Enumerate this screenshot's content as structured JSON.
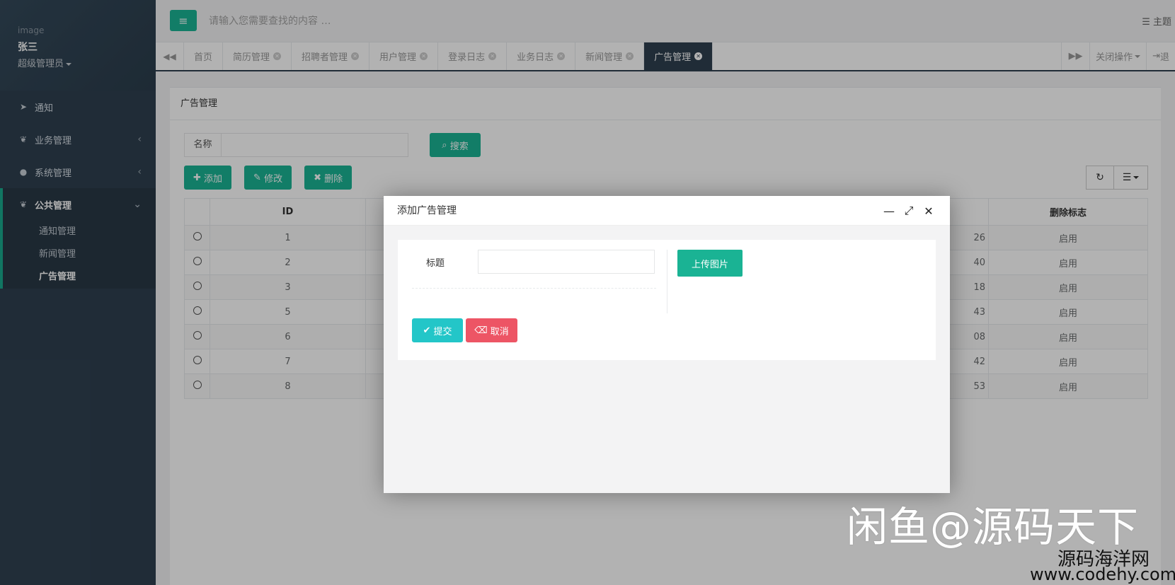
{
  "sidebar": {
    "profile": {
      "image_alt": "image",
      "name": "张三",
      "role": "超级管理员"
    },
    "items": [
      {
        "label": "通知"
      },
      {
        "label": "业务管理"
      },
      {
        "label": "系统管理"
      },
      {
        "label": "公共管理"
      }
    ],
    "sub_items": [
      {
        "label": "通知管理"
      },
      {
        "label": "新闻管理"
      },
      {
        "label": "广告管理"
      }
    ]
  },
  "topbar": {
    "search_placeholder": "请输入您需要查找的内容 …",
    "theme_label": "主题"
  },
  "tabs": {
    "items": [
      {
        "label": "首页"
      },
      {
        "label": "简历管理"
      },
      {
        "label": "招聘者管理"
      },
      {
        "label": "用户管理"
      },
      {
        "label": "登录日志"
      },
      {
        "label": "业务日志"
      },
      {
        "label": "新闻管理"
      },
      {
        "label": "广告管理"
      }
    ],
    "close_ops_label": "关闭操作",
    "logout_label": "退"
  },
  "page": {
    "title": "广告管理",
    "search_label": "名称",
    "search_button": "搜索",
    "add_button": "添加",
    "edit_button": "修改",
    "delete_button": "删除"
  },
  "table": {
    "headers": {
      "id": "ID",
      "flag": "删除标志"
    },
    "rows": [
      {
        "id": "1",
        "partial": "26",
        "flag": "启用"
      },
      {
        "id": "2",
        "partial": "40",
        "flag": "启用"
      },
      {
        "id": "3",
        "partial": "18",
        "flag": "启用"
      },
      {
        "id": "5",
        "partial": "43",
        "flag": "启用"
      },
      {
        "id": "6",
        "partial": "08",
        "flag": "启用"
      },
      {
        "id": "7",
        "partial": "42",
        "flag": "启用"
      },
      {
        "id": "8",
        "partial": "53",
        "flag": "启用"
      }
    ]
  },
  "modal": {
    "title": "添加广告管理",
    "field_label": "标题",
    "field_value": "",
    "upload_button": "上传图片",
    "submit_button": "提交",
    "cancel_button": "取消"
  },
  "watermark": {
    "line1": "闲鱼@源码天下",
    "line2": "源码海洋网",
    "line3": "www.codehy.com"
  },
  "colors": {
    "sidebar_bg": "#2f4050",
    "primary": "#1ab394",
    "info": "#23c6c8",
    "danger": "#ed5565"
  }
}
